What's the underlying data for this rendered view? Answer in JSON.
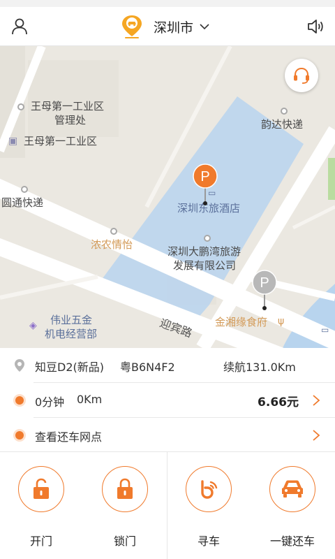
{
  "header": {
    "city": "深圳市",
    "user_icon": "user-icon",
    "sound_icon": "speaker-icon",
    "logo_icon": "car-location-logo"
  },
  "map": {
    "labels": {
      "industrial_mgmt_1": "王母第一工业区",
      "industrial_mgmt_2": "管理处",
      "industrial_zone": "王母第一工业区",
      "yunda": "韵达快递",
      "yuantong": "圆通快递",
      "hotel": "深圳东旅酒店",
      "nongnong": "浓农情怡",
      "company_1": "深圳大鹏湾旅游",
      "company_2": "发展有限公司",
      "hardware_1": "伟业五金",
      "hardware_2": "机电经营部",
      "road": "迎宾路",
      "restaurant": "金湘缘食府"
    },
    "pins": {
      "active": "P",
      "inactive": "P"
    },
    "colors": {
      "accent": "#f07a2c",
      "park_area": "#b8d4ee"
    }
  },
  "car_info": {
    "model": "知豆D2(新品)",
    "plate": "粤B6N4F2",
    "range": "续航131.0Km"
  },
  "trip": {
    "duration": "0分钟",
    "distance": "0Km",
    "fee": "6.66元"
  },
  "return_points": {
    "label": "查看还车网点"
  },
  "actions": {
    "open": "开门",
    "lock": "锁门",
    "find": "寻车",
    "return": "一键还车"
  }
}
